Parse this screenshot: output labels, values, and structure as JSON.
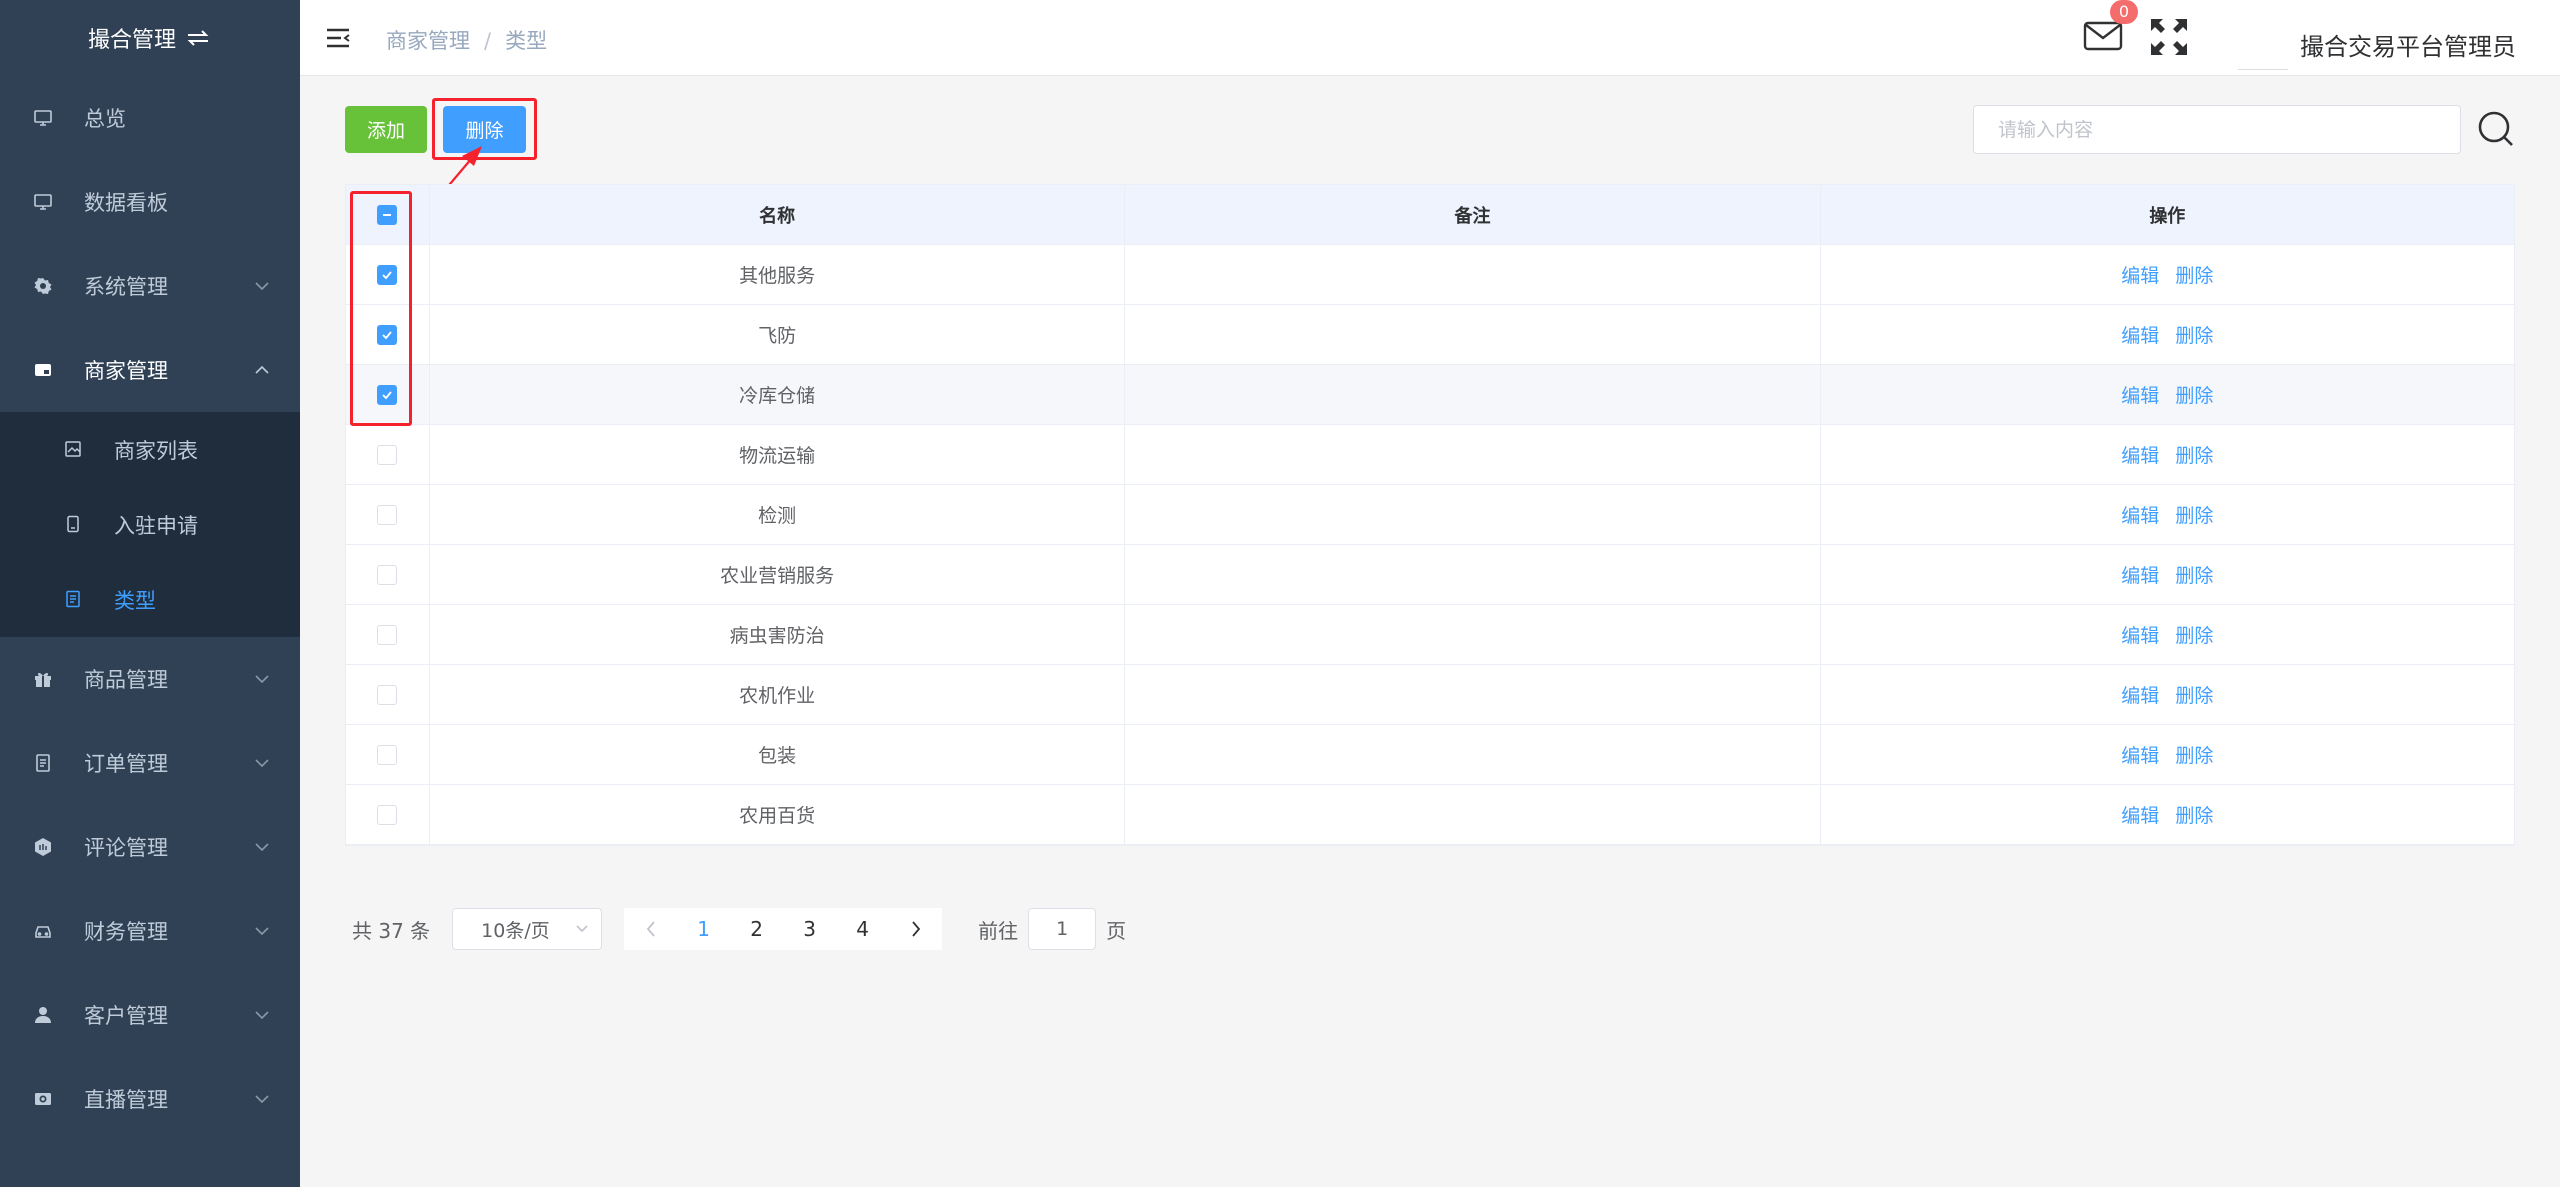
{
  "sidebar": {
    "logo_title": "撮合管理",
    "items": [
      {
        "label": "总览",
        "icon": "monitor-icon"
      },
      {
        "label": "数据看板",
        "icon": "monitor-icon"
      },
      {
        "label": "系统管理",
        "icon": "gear-icon"
      },
      {
        "label": "商家管理",
        "icon": "store-icon"
      },
      {
        "label": "商品管理",
        "icon": "gift-icon"
      },
      {
        "label": "订单管理",
        "icon": "document-icon"
      },
      {
        "label": "评论管理",
        "icon": "hexagon-icon"
      },
      {
        "label": "财务管理",
        "icon": "car-icon"
      },
      {
        "label": "客户管理",
        "icon": "user-icon"
      },
      {
        "label": "直播管理",
        "icon": "camera-icon"
      }
    ],
    "submenu": [
      {
        "label": "商家列表",
        "icon": "picture-icon"
      },
      {
        "label": "入驻申请",
        "icon": "tablet-icon"
      },
      {
        "label": "类型",
        "icon": "list-icon"
      }
    ]
  },
  "header": {
    "breadcrumb": [
      "商家管理",
      "类型"
    ],
    "message_count": "0",
    "username": "撮合交易平台管理员"
  },
  "toolbar": {
    "add_label": "添加",
    "delete_label": "删除",
    "search_placeholder": "请输入内容"
  },
  "table": {
    "columns": [
      "名称",
      "备注",
      "操作"
    ],
    "edit_label": "编辑",
    "delete_label": "删除",
    "rows": [
      {
        "name": "其他服务",
        "remark": "",
        "checked": true
      },
      {
        "name": "飞防",
        "remark": "",
        "checked": true
      },
      {
        "name": "冷库仓储",
        "remark": "",
        "checked": true
      },
      {
        "name": "物流运输",
        "remark": "",
        "checked": false
      },
      {
        "name": "检测",
        "remark": "",
        "checked": false
      },
      {
        "name": "农业营销服务",
        "remark": "",
        "checked": false
      },
      {
        "name": "病虫害防治",
        "remark": "",
        "checked": false
      },
      {
        "name": "农机作业",
        "remark": "",
        "checked": false
      },
      {
        "name": "包装",
        "remark": "",
        "checked": false
      },
      {
        "name": "农用百货",
        "remark": "",
        "checked": false
      }
    ]
  },
  "pagination": {
    "total_text": "共 37 条",
    "page_size": "10条/页",
    "pages": [
      "1",
      "2",
      "3",
      "4"
    ],
    "current_page": "1",
    "goto_prefix": "前往",
    "goto_value": "1",
    "goto_suffix": "页"
  },
  "colors": {
    "sidebar_bg": "#304156",
    "submenu_bg": "#1f2d3d",
    "primary": "#409eff",
    "success": "#67c23a",
    "annotation_red": "#f5222d"
  }
}
